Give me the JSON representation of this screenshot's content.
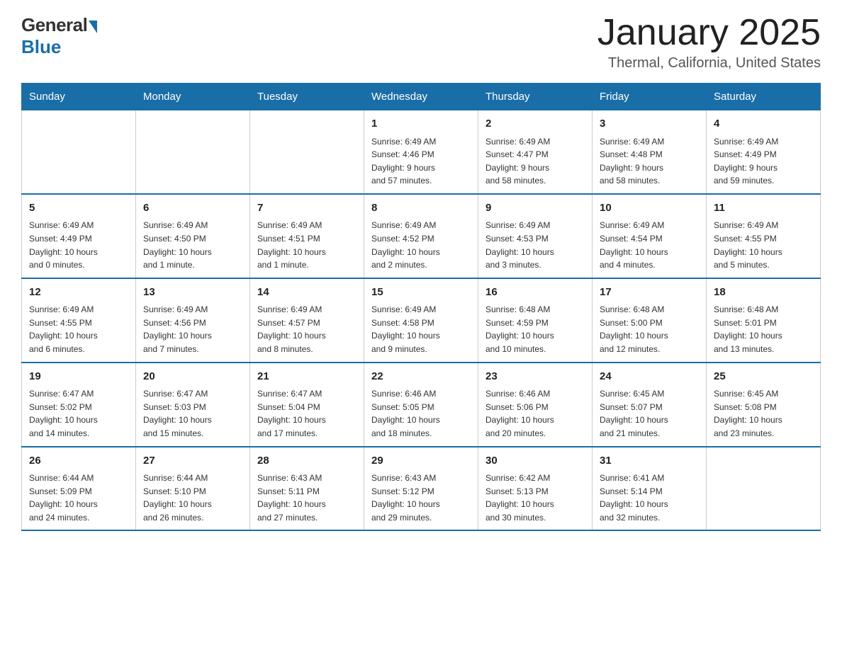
{
  "logo": {
    "general": "General",
    "blue": "Blue"
  },
  "title": "January 2025",
  "location": "Thermal, California, United States",
  "weekdays": [
    "Sunday",
    "Monday",
    "Tuesday",
    "Wednesday",
    "Thursday",
    "Friday",
    "Saturday"
  ],
  "weeks": [
    [
      {
        "day": "",
        "info": ""
      },
      {
        "day": "",
        "info": ""
      },
      {
        "day": "",
        "info": ""
      },
      {
        "day": "1",
        "info": "Sunrise: 6:49 AM\nSunset: 4:46 PM\nDaylight: 9 hours\nand 57 minutes."
      },
      {
        "day": "2",
        "info": "Sunrise: 6:49 AM\nSunset: 4:47 PM\nDaylight: 9 hours\nand 58 minutes."
      },
      {
        "day": "3",
        "info": "Sunrise: 6:49 AM\nSunset: 4:48 PM\nDaylight: 9 hours\nand 58 minutes."
      },
      {
        "day": "4",
        "info": "Sunrise: 6:49 AM\nSunset: 4:49 PM\nDaylight: 9 hours\nand 59 minutes."
      }
    ],
    [
      {
        "day": "5",
        "info": "Sunrise: 6:49 AM\nSunset: 4:49 PM\nDaylight: 10 hours\nand 0 minutes."
      },
      {
        "day": "6",
        "info": "Sunrise: 6:49 AM\nSunset: 4:50 PM\nDaylight: 10 hours\nand 1 minute."
      },
      {
        "day": "7",
        "info": "Sunrise: 6:49 AM\nSunset: 4:51 PM\nDaylight: 10 hours\nand 1 minute."
      },
      {
        "day": "8",
        "info": "Sunrise: 6:49 AM\nSunset: 4:52 PM\nDaylight: 10 hours\nand 2 minutes."
      },
      {
        "day": "9",
        "info": "Sunrise: 6:49 AM\nSunset: 4:53 PM\nDaylight: 10 hours\nand 3 minutes."
      },
      {
        "day": "10",
        "info": "Sunrise: 6:49 AM\nSunset: 4:54 PM\nDaylight: 10 hours\nand 4 minutes."
      },
      {
        "day": "11",
        "info": "Sunrise: 6:49 AM\nSunset: 4:55 PM\nDaylight: 10 hours\nand 5 minutes."
      }
    ],
    [
      {
        "day": "12",
        "info": "Sunrise: 6:49 AM\nSunset: 4:55 PM\nDaylight: 10 hours\nand 6 minutes."
      },
      {
        "day": "13",
        "info": "Sunrise: 6:49 AM\nSunset: 4:56 PM\nDaylight: 10 hours\nand 7 minutes."
      },
      {
        "day": "14",
        "info": "Sunrise: 6:49 AM\nSunset: 4:57 PM\nDaylight: 10 hours\nand 8 minutes."
      },
      {
        "day": "15",
        "info": "Sunrise: 6:49 AM\nSunset: 4:58 PM\nDaylight: 10 hours\nand 9 minutes."
      },
      {
        "day": "16",
        "info": "Sunrise: 6:48 AM\nSunset: 4:59 PM\nDaylight: 10 hours\nand 10 minutes."
      },
      {
        "day": "17",
        "info": "Sunrise: 6:48 AM\nSunset: 5:00 PM\nDaylight: 10 hours\nand 12 minutes."
      },
      {
        "day": "18",
        "info": "Sunrise: 6:48 AM\nSunset: 5:01 PM\nDaylight: 10 hours\nand 13 minutes."
      }
    ],
    [
      {
        "day": "19",
        "info": "Sunrise: 6:47 AM\nSunset: 5:02 PM\nDaylight: 10 hours\nand 14 minutes."
      },
      {
        "day": "20",
        "info": "Sunrise: 6:47 AM\nSunset: 5:03 PM\nDaylight: 10 hours\nand 15 minutes."
      },
      {
        "day": "21",
        "info": "Sunrise: 6:47 AM\nSunset: 5:04 PM\nDaylight: 10 hours\nand 17 minutes."
      },
      {
        "day": "22",
        "info": "Sunrise: 6:46 AM\nSunset: 5:05 PM\nDaylight: 10 hours\nand 18 minutes."
      },
      {
        "day": "23",
        "info": "Sunrise: 6:46 AM\nSunset: 5:06 PM\nDaylight: 10 hours\nand 20 minutes."
      },
      {
        "day": "24",
        "info": "Sunrise: 6:45 AM\nSunset: 5:07 PM\nDaylight: 10 hours\nand 21 minutes."
      },
      {
        "day": "25",
        "info": "Sunrise: 6:45 AM\nSunset: 5:08 PM\nDaylight: 10 hours\nand 23 minutes."
      }
    ],
    [
      {
        "day": "26",
        "info": "Sunrise: 6:44 AM\nSunset: 5:09 PM\nDaylight: 10 hours\nand 24 minutes."
      },
      {
        "day": "27",
        "info": "Sunrise: 6:44 AM\nSunset: 5:10 PM\nDaylight: 10 hours\nand 26 minutes."
      },
      {
        "day": "28",
        "info": "Sunrise: 6:43 AM\nSunset: 5:11 PM\nDaylight: 10 hours\nand 27 minutes."
      },
      {
        "day": "29",
        "info": "Sunrise: 6:43 AM\nSunset: 5:12 PM\nDaylight: 10 hours\nand 29 minutes."
      },
      {
        "day": "30",
        "info": "Sunrise: 6:42 AM\nSunset: 5:13 PM\nDaylight: 10 hours\nand 30 minutes."
      },
      {
        "day": "31",
        "info": "Sunrise: 6:41 AM\nSunset: 5:14 PM\nDaylight: 10 hours\nand 32 minutes."
      },
      {
        "day": "",
        "info": ""
      }
    ]
  ]
}
